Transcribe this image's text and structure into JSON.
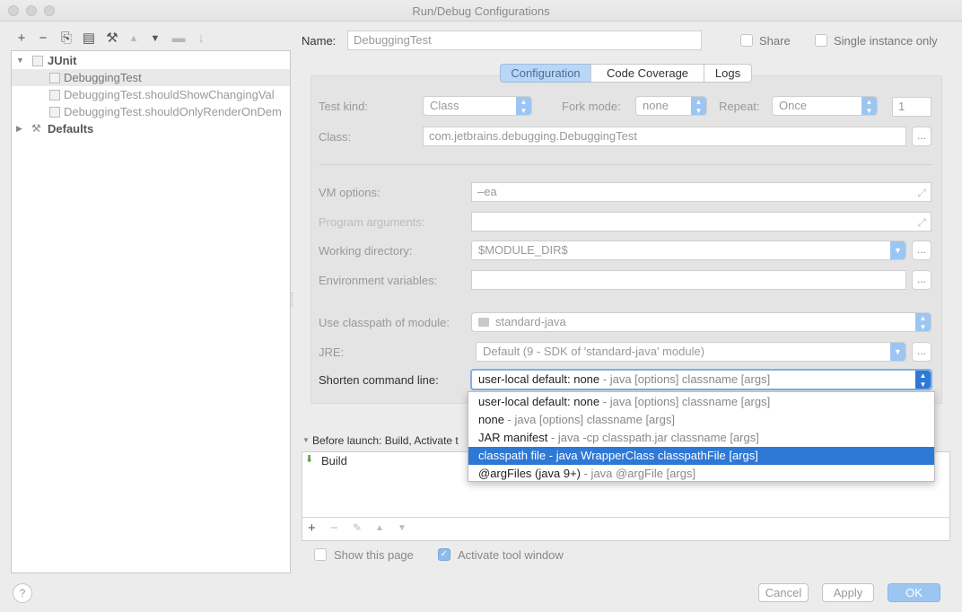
{
  "window": {
    "title": "Run/Debug Configurations"
  },
  "toolbar": {
    "add": "+",
    "remove": "−",
    "copy": "⎘",
    "save": "▤",
    "wrench": "⚒",
    "up": "▲",
    "down": "▼",
    "folder": "▬",
    "sort": "↓"
  },
  "tree": {
    "junit": "JUnit",
    "items": [
      "DebuggingTest",
      "DebuggingTest.shouldShowChangingVal",
      "DebuggingTest.shouldOnlyRenderOnDem"
    ],
    "defaults": "Defaults"
  },
  "header": {
    "name_label": "Name:",
    "name_value": "DebuggingTest",
    "share_label": "Share",
    "single_instance_label": "Single instance only"
  },
  "tabs": [
    "Configuration",
    "Code Coverage",
    "Logs"
  ],
  "form": {
    "test_kind_label": "Test kind:",
    "test_kind_value": "Class",
    "fork_mode_label": "Fork mode:",
    "fork_mode_value": "none",
    "repeat_label": "Repeat:",
    "repeat_value": "Once",
    "repeat_count": "1",
    "class_label": "Class:",
    "class_value": "com.jetbrains.debugging.DebuggingTest",
    "vm_options_label": "VM options:",
    "vm_options_value": "–ea",
    "program_args_label": "Program arguments:",
    "working_dir_label": "Working directory:",
    "working_dir_value": "$MODULE_DIR$",
    "env_vars_label": "Environment variables:",
    "classpath_label": "Use classpath of module:",
    "classpath_value": "standard-java",
    "jre_label": "JRE:",
    "jre_value": "Default (9 - SDK of 'standard-java' module)",
    "shorten_label": "Shorten command line:",
    "shorten_main": "user-local default: none",
    "shorten_hint": " - java [options] classname [args]",
    "dots": "..."
  },
  "dropdown": {
    "options": [
      {
        "main": "user-local default: none",
        "hint": " - java [options] classname [args]",
        "selected": false
      },
      {
        "main": "none",
        "hint": " - java [options] classname [args]",
        "selected": false
      },
      {
        "main": "JAR manifest",
        "hint": " - java -cp classpath.jar classname [args]",
        "selected": false
      },
      {
        "main": "classpath file",
        "hint": " - java WrapperClass classpathFile [args]",
        "selected": true
      },
      {
        "main": "@argFiles (java 9+)",
        "hint": " - java @argFile [args]",
        "selected": false
      }
    ]
  },
  "before_launch": {
    "label": "Before launch: Build, Activate t",
    "build_item": "Build",
    "add": "+",
    "remove": "−",
    "edit": "✎",
    "up": "▲",
    "down": "▼"
  },
  "footer": {
    "show_page_label": "Show this page",
    "activate_tool_label": "Activate tool window",
    "help": "?",
    "cancel": "Cancel",
    "apply": "Apply",
    "ok": "OK"
  },
  "colors": {
    "accent": "#2e78d6",
    "tab_active": "#b9d6f5",
    "button_primary": "#9cc6f2"
  }
}
